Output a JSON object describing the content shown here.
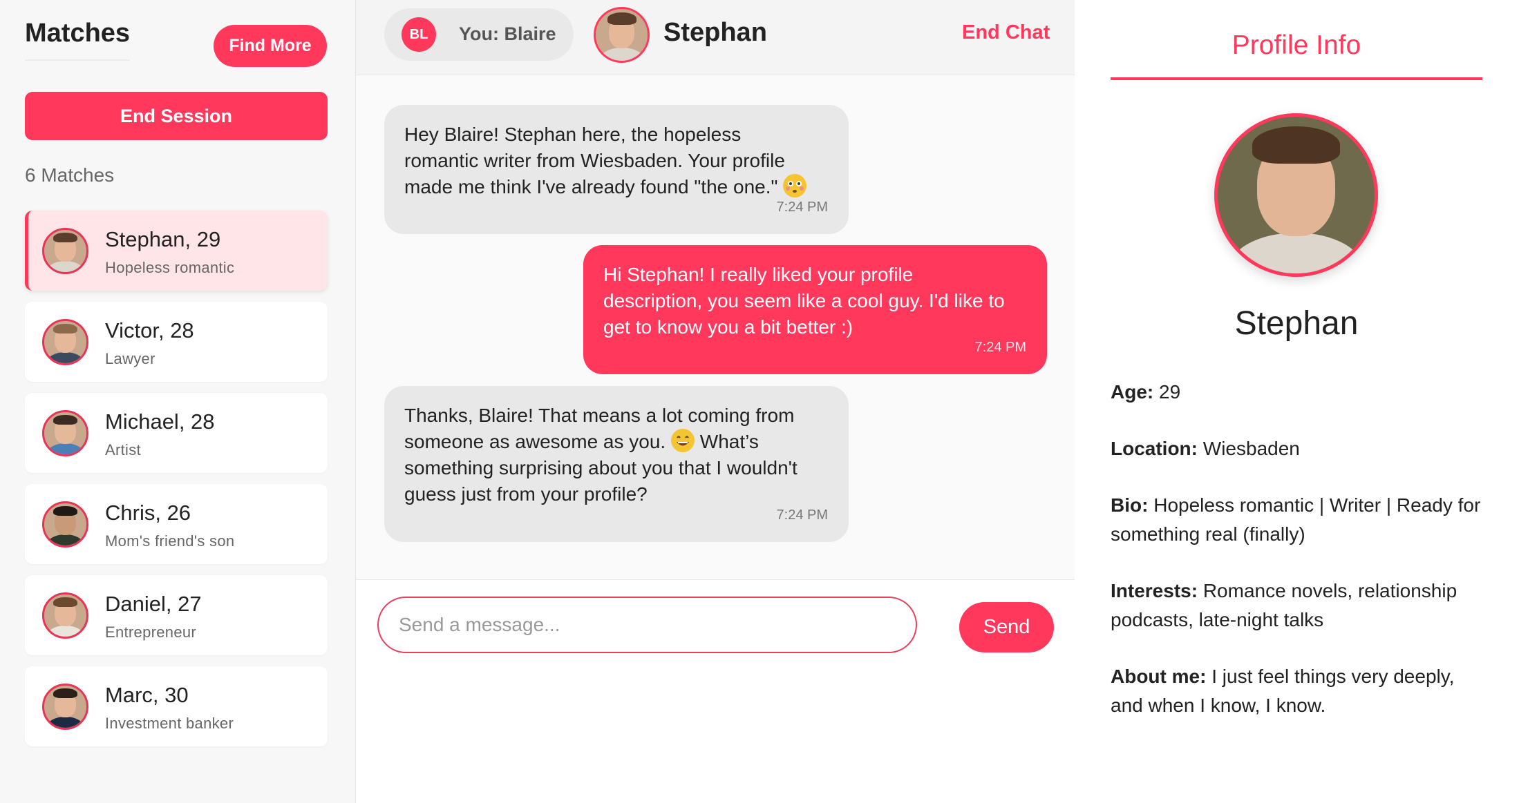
{
  "sidebar": {
    "title": "Matches",
    "find_more_label": "Find More",
    "end_session_label": "End Session",
    "match_count": "6 Matches",
    "matches": [
      {
        "name": "Stephan, 29",
        "subtitle": "Hopeless romantic",
        "active": true
      },
      {
        "name": "Victor, 28",
        "subtitle": "Lawyer"
      },
      {
        "name": "Michael, 28",
        "subtitle": "Artist"
      },
      {
        "name": "Chris, 26",
        "subtitle": "Mom's friend's son"
      },
      {
        "name": "Daniel, 27",
        "subtitle": "Entrepreneur"
      },
      {
        "name": "Marc, 30",
        "subtitle": "Investment banker"
      }
    ]
  },
  "chat": {
    "you_initials": "BL",
    "you_label": "You: Blaire",
    "contact_name": "Stephan",
    "end_chat_label": "End Chat",
    "messages": [
      {
        "direction": "in",
        "text_lines": [
          "Hey Blaire! Stephan here, the hopeless",
          "romantic writer from Wiesbaden. Your profile",
          "made me think I've already found \"the one.\""
        ],
        "emoji": "flushed-face",
        "time": "7:24 PM"
      },
      {
        "direction": "out",
        "text_lines": [
          "Hi Stephan! I really liked your profile",
          "description, you seem like a cool guy. I'd like to",
          "get to know you a bit better :)"
        ],
        "time": "7:24 PM"
      },
      {
        "direction": "in",
        "text_lines": [
          "Thanks, Blaire! That means a lot coming from",
          "someone as awesome as you.",
          "What’s",
          "something surprising about you that I wouldn't",
          "guess just from your profile?"
        ],
        "emoji": "grinning-face",
        "time": "7:24 PM"
      }
    ],
    "input_placeholder": "Send a message...",
    "input_value": "",
    "send_label": "Send"
  },
  "profile": {
    "title": "Profile Info",
    "name": "Stephan",
    "fields": [
      {
        "label": "Age:",
        "value": "29"
      },
      {
        "label": "Location:",
        "value": "Wiesbaden"
      },
      {
        "label": "Bio:",
        "value": "Hopeless romantic | Writer | Ready for something real (finally)"
      },
      {
        "label": "Interests:",
        "value": "Romance novels, relationship podcasts, late-night talks"
      },
      {
        "label": "About me:",
        "value": "I just feel things very deeply, and when I know, I know."
      }
    ]
  },
  "colors": {
    "accent": "#ff385c",
    "active_card": "#ffe4e8",
    "incoming_bubble": "#e8e8e8"
  }
}
